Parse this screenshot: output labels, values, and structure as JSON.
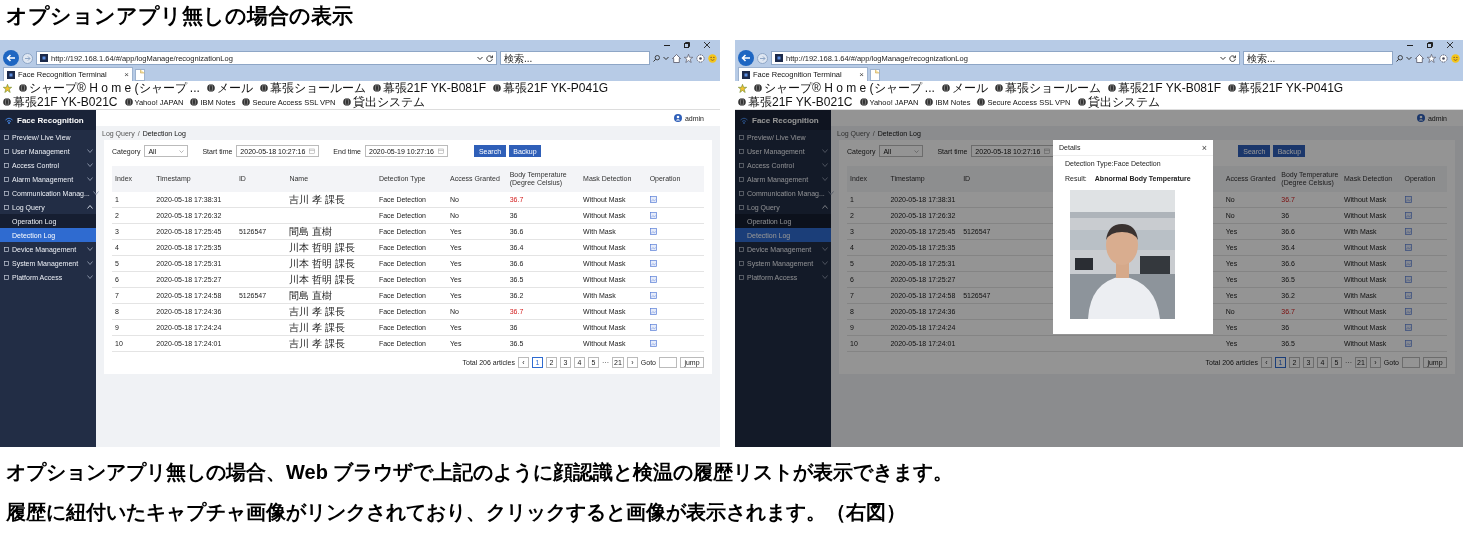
{
  "title": "オプションアプリ無しの場合の表示",
  "screenshots": [
    {
      "browser": {
        "url": "http://192.168.1.64/#/app/logManage/recognizationLog",
        "search": {
          "placeholder": "検索..."
        },
        "tab": "Face Recognition Terminal",
        "tab_close": "×",
        "bookmarks": [
          "シャープ® H o m e (シャープ ...",
          "メール",
          "幕張ショールーム",
          "幕張21F YK-B081F",
          "幕張21F YK-P041G",
          "幕張21F YK-B021C",
          "Yahoo! JAPAN",
          "IBM Notes",
          "Secure Access SSL VPN",
          "貸出システム"
        ]
      },
      "app": {
        "brand": "Face Recognition",
        "user": "admin",
        "sidebar": [
          {
            "label": "Preview/ Live View",
            "selected": false
          },
          {
            "label": "User Management",
            "selected": false,
            "expanded": false
          },
          {
            "label": "Access Control",
            "selected": false,
            "expanded": false
          },
          {
            "label": "Alarm Management",
            "selected": false,
            "expanded": false
          },
          {
            "label": "Communication Manag...",
            "selected": false,
            "expanded": false
          },
          {
            "label": "Log Query",
            "selected": false,
            "expanded": true,
            "children": [
              {
                "label": "Operation Log",
                "selected": false
              },
              {
                "label": "Detection Log",
                "selected": true
              }
            ]
          },
          {
            "label": "Device Management",
            "selected": false,
            "expanded": false
          },
          {
            "label": "System Management",
            "selected": false,
            "expanded": false
          },
          {
            "label": "Platform Access",
            "selected": false,
            "expanded": false
          }
        ],
        "breadcrumb": [
          "Log Query",
          "/",
          "Detection Log"
        ],
        "filters": [
          {
            "kind": "select",
            "label": "Category",
            "value": "All"
          },
          {
            "kind": "date",
            "label": "Start time",
            "value": "2020-05-18 10:27:16"
          },
          {
            "kind": "date",
            "label": "End time",
            "value": "2020-05-19 10:27:16"
          }
        ],
        "buttons": [
          "Search",
          "Backup"
        ],
        "table": {
          "columns": [
            {
              "label": "Index",
              "kind": "text"
            },
            {
              "label": "Timestamp",
              "kind": "text"
            },
            {
              "label": "ID",
              "kind": "text"
            },
            {
              "label": "Name",
              "kind": "text"
            },
            {
              "label": "Detection Type",
              "kind": "text"
            },
            {
              "label": "Access Granted",
              "kind": "text"
            },
            {
              "label": "Body Temperature (Degree Celsius)",
              "kind": "temperature"
            },
            {
              "label": "Mask Detection",
              "kind": "text"
            },
            {
              "label": "Operation",
              "kind": "icon"
            }
          ],
          "rows": [
            {
              "cells": [
                "1",
                "2020-05-18 17:38:31",
                "",
                "吉川 孝 課長",
                "Face Detection",
                "No",
                "36.7",
                "Without Mask"
              ],
              "fever": true
            },
            {
              "cells": [
                "2",
                "2020-05-18 17:26:32",
                "",
                "",
                "Face Detection",
                "No",
                "36",
                "Without Mask"
              ],
              "fever": false
            },
            {
              "cells": [
                "3",
                "2020-05-18 17:25:45",
                "5126547",
                "間島 直樹",
                "Face Detection",
                "Yes",
                "36.6",
                "With Mask"
              ],
              "fever": false
            },
            {
              "cells": [
                "4",
                "2020-05-18 17:25:35",
                "",
                "川本 哲明 課長",
                "Face Detection",
                "Yes",
                "36.4",
                "Without Mask"
              ],
              "fever": false
            },
            {
              "cells": [
                "5",
                "2020-05-18 17:25:31",
                "",
                "川本 哲明 課長",
                "Face Detection",
                "Yes",
                "36.6",
                "Without Mask"
              ],
              "fever": false
            },
            {
              "cells": [
                "6",
                "2020-05-18 17:25:27",
                "",
                "川本 哲明 課長",
                "Face Detection",
                "Yes",
                "36.5",
                "Without Mask"
              ],
              "fever": false
            },
            {
              "cells": [
                "7",
                "2020-05-18 17:24:58",
                "5126547",
                "間島 直樹",
                "Face Detection",
                "Yes",
                "36.2",
                "With Mask"
              ],
              "fever": false
            },
            {
              "cells": [
                "8",
                "2020-05-18 17:24:36",
                "",
                "吉川 孝 課長",
                "Face Detection",
                "No",
                "36.7",
                "Without Mask"
              ],
              "fever": true
            },
            {
              "cells": [
                "9",
                "2020-05-18 17:24:24",
                "",
                "吉川 孝 課長",
                "Face Detection",
                "Yes",
                "36",
                "Without Mask"
              ],
              "fever": false
            },
            {
              "cells": [
                "10",
                "2020-05-18 17:24:01",
                "",
                "吉川 孝 課長",
                "Face Detection",
                "Yes",
                "36.5",
                "Without Mask"
              ],
              "fever": false
            }
          ]
        },
        "pagination": {
          "total": "Total 206 articles",
          "pages": [
            {
              "label": "‹",
              "kind": "arrow",
              "selected": false
            },
            {
              "label": "1",
              "kind": "page",
              "selected": true
            },
            {
              "label": "2",
              "kind": "page",
              "selected": false
            },
            {
              "label": "3",
              "kind": "page",
              "selected": false
            },
            {
              "label": "4",
              "kind": "page",
              "selected": false
            },
            {
              "label": "5",
              "kind": "page",
              "selected": false
            },
            {
              "label": "···",
              "kind": "ellipsis",
              "selected": false
            },
            {
              "label": "21",
              "kind": "page",
              "selected": false
            },
            {
              "label": "›",
              "kind": "arrow",
              "selected": false
            }
          ],
          "goto": "Goto",
          "jump": "jump"
        }
      }
    },
    {
      "browser": {
        "url": "http://192.168.1.64/#/app/logManage/recognizationLog",
        "search": {
          "placeholder": "検索..."
        },
        "tab": "Face Recognition Terminal",
        "tab_close": "×",
        "bookmarks": [
          "シャープ® H o m e (シャープ ...",
          "メール",
          "幕張ショールーム",
          "幕張21F YK-B081F",
          "幕張21F YK-P041G",
          "幕張21F YK-B021C",
          "Yahoo! JAPAN",
          "IBM Notes",
          "Secure Access SSL VPN",
          "貸出システム"
        ]
      },
      "app": {
        "brand": "Face Recognition",
        "user": "admin",
        "sidebar": [
          {
            "label": "Preview/ Live View",
            "selected": false
          },
          {
            "label": "User Management",
            "selected": false,
            "expanded": false
          },
          {
            "label": "Access Control",
            "selected": false,
            "expanded": false
          },
          {
            "label": "Alarm Management",
            "selected": false,
            "expanded": false
          },
          {
            "label": "Communication Manag...",
            "selected": false,
            "expanded": false
          },
          {
            "label": "Log Query",
            "selected": false,
            "expanded": true,
            "children": [
              {
                "label": "Operation Log",
                "selected": false
              },
              {
                "label": "Detection Log",
                "selected": true
              }
            ]
          },
          {
            "label": "Device Management",
            "selected": false,
            "expanded": false
          },
          {
            "label": "System Management",
            "selected": false,
            "expanded": false
          },
          {
            "label": "Platform Access",
            "selected": false,
            "expanded": false
          }
        ],
        "breadcrumb": [
          "Log Query",
          "/",
          "Detection Log"
        ],
        "filters": [
          {
            "kind": "select",
            "label": "Category",
            "value": "All"
          },
          {
            "kind": "date",
            "label": "Start time",
            "value": "2020-05-18 10:27:16"
          }
        ],
        "buttons": [
          "Search",
          "Backup"
        ],
        "table": {
          "columns": [
            {
              "label": "Index",
              "kind": "text"
            },
            {
              "label": "Timestamp",
              "kind": "text"
            },
            {
              "label": "ID",
              "kind": "text"
            },
            {
              "label": "Access Granted",
              "kind": "text"
            },
            {
              "label": "Body Temperature (Degree Celsius)",
              "kind": "temperature"
            },
            {
              "label": "Mask Detection",
              "kind": "text"
            },
            {
              "label": "Operation",
              "kind": "icon"
            }
          ],
          "rows": [
            {
              "cells": [
                "1",
                "2020-05-18 17:38:31",
                "",
                "No",
                "36.7",
                "Without Mask"
              ],
              "fever": true
            },
            {
              "cells": [
                "2",
                "2020-05-18 17:26:32",
                "",
                "No",
                "36",
                "Without Mask"
              ],
              "fever": false
            },
            {
              "cells": [
                "3",
                "2020-05-18 17:25:45",
                "5126547",
                "Yes",
                "36.6",
                "With Mask"
              ],
              "fever": false
            },
            {
              "cells": [
                "4",
                "2020-05-18 17:25:35",
                "",
                "Yes",
                "36.4",
                "Without Mask"
              ],
              "fever": false
            },
            {
              "cells": [
                "5",
                "2020-05-18 17:25:31",
                "",
                "Yes",
                "36.6",
                "Without Mask"
              ],
              "fever": false
            },
            {
              "cells": [
                "6",
                "2020-05-18 17:25:27",
                "",
                "Yes",
                "36.5",
                "Without Mask"
              ],
              "fever": false
            },
            {
              "cells": [
                "7",
                "2020-05-18 17:24:58",
                "5126547",
                "Yes",
                "36.2",
                "With Mask"
              ],
              "fever": false
            },
            {
              "cells": [
                "8",
                "2020-05-18 17:24:36",
                "",
                "No",
                "36.7",
                "Without Mask"
              ],
              "fever": true
            },
            {
              "cells": [
                "9",
                "2020-05-18 17:24:24",
                "",
                "Yes",
                "36",
                "Without Mask"
              ],
              "fever": false
            },
            {
              "cells": [
                "10",
                "2020-05-18 17:24:01",
                "",
                "Yes",
                "36.5",
                "Without Mask"
              ],
              "fever": false
            }
          ]
        },
        "pagination": {
          "total": "Total 206 articles",
          "pages": [
            {
              "label": "‹",
              "kind": "arrow",
              "selected": false
            },
            {
              "label": "1",
              "kind": "page",
              "selected": true
            },
            {
              "label": "2",
              "kind": "page",
              "selected": false
            },
            {
              "label": "3",
              "kind": "page",
              "selected": false
            },
            {
              "label": "4",
              "kind": "page",
              "selected": false
            },
            {
              "label": "5",
              "kind": "page",
              "selected": false
            },
            {
              "label": "···",
              "kind": "ellipsis",
              "selected": false
            },
            {
              "label": "21",
              "kind": "page",
              "selected": false
            },
            {
              "label": "›",
              "kind": "arrow",
              "selected": false
            }
          ],
          "goto": "Goto",
          "jump": "jump"
        },
        "modal": {
          "title": "Details",
          "close": "×",
          "detection_type": "Detection Type:Face Detection",
          "result_label": "Result:",
          "result": "Abnormal Body Temperature"
        }
      }
    }
  ],
  "captions": [
    "オプションアプリ無しの場合、Web ブラウザで上記のように顔認識と検温の履歴リストが表示できます。",
    "履歴に紐付いたキャプチャ画像がリンクされており、クリックすると画像が表示されます。（右図）"
  ]
}
